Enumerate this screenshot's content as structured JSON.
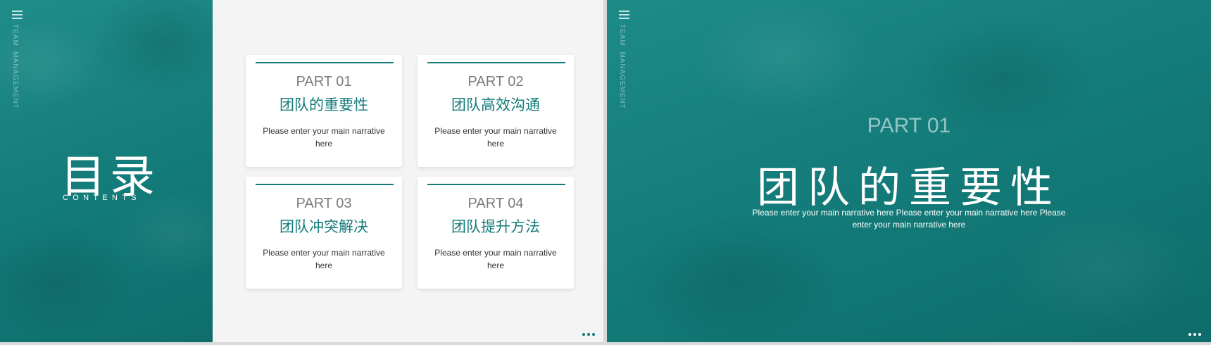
{
  "left_slide": {
    "side_label": "TEAM  MANAGEMENT",
    "title": "目录",
    "subtitle": "CONTENTS",
    "cards": [
      {
        "part": "PART 01",
        "title": "团队的重要性",
        "desc": "Please enter your main narrative here"
      },
      {
        "part": "PART 02",
        "title": "团队高效沟通",
        "desc": "Please enter your main narrative here"
      },
      {
        "part": "PART 03",
        "title": "团队冲突解决",
        "desc": "Please enter your main narrative here"
      },
      {
        "part": "PART 04",
        "title": "团队提升方法",
        "desc": "Please enter your main narrative here"
      }
    ]
  },
  "right_slide": {
    "side_label": "TEAM  MANAGEMENT",
    "part": "PART 01",
    "title": "团队的重要性",
    "desc": "Please enter your main narrative here Please enter your main narrative here Please enter your main narrative here"
  },
  "colors": {
    "accent": "#137b79",
    "card_bg": "#ffffff",
    "page_bg": "#f4f4f4"
  },
  "icons": {
    "menu": "hamburger-menu-icon",
    "more": "more-dots-icon"
  }
}
